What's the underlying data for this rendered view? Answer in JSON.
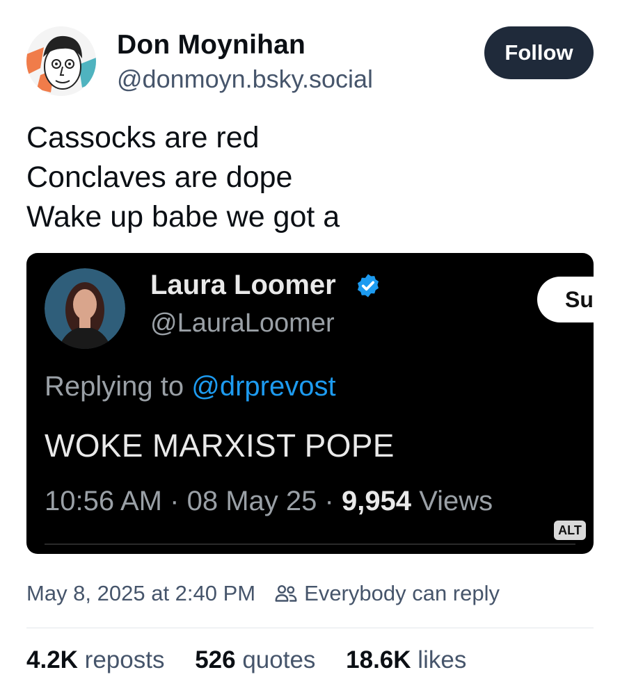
{
  "post": {
    "author_name": "Don Moynihan",
    "author_handle": "@donmoyn.bsky.social",
    "follow_label": "Follow",
    "text_lines": [
      "Cassocks are red",
      "Conclaves are dope",
      "Wake up babe we got a"
    ],
    "timestamp": "May 8, 2025 at 2:40 PM",
    "reply_setting": "Everybody can reply",
    "stats": {
      "reposts_count": "4.2K",
      "reposts_label": "reposts",
      "quotes_count": "526",
      "quotes_label": "quotes",
      "likes_count": "18.6K",
      "likes_label": "likes"
    }
  },
  "embed": {
    "name": "Laura Loomer",
    "handle": "@LauraLoomer",
    "subscribe_label": "Su",
    "replying_prefix": "Replying to ",
    "replying_to": "@drprevost",
    "content": "WOKE MARXIST POPE",
    "time": "10:56 AM",
    "date": "08 May 25",
    "views_count": "9,954",
    "views_label": "Views",
    "alt_label": "ALT"
  },
  "colors": {
    "follow_bg": "#1f2a3a",
    "verified": "#1d9bf0",
    "mention": "#1d9bf0",
    "secondary_text": "#46556b"
  },
  "icons": [
    "cartoon-avatar",
    "verified-check-icon",
    "people-icon"
  ]
}
